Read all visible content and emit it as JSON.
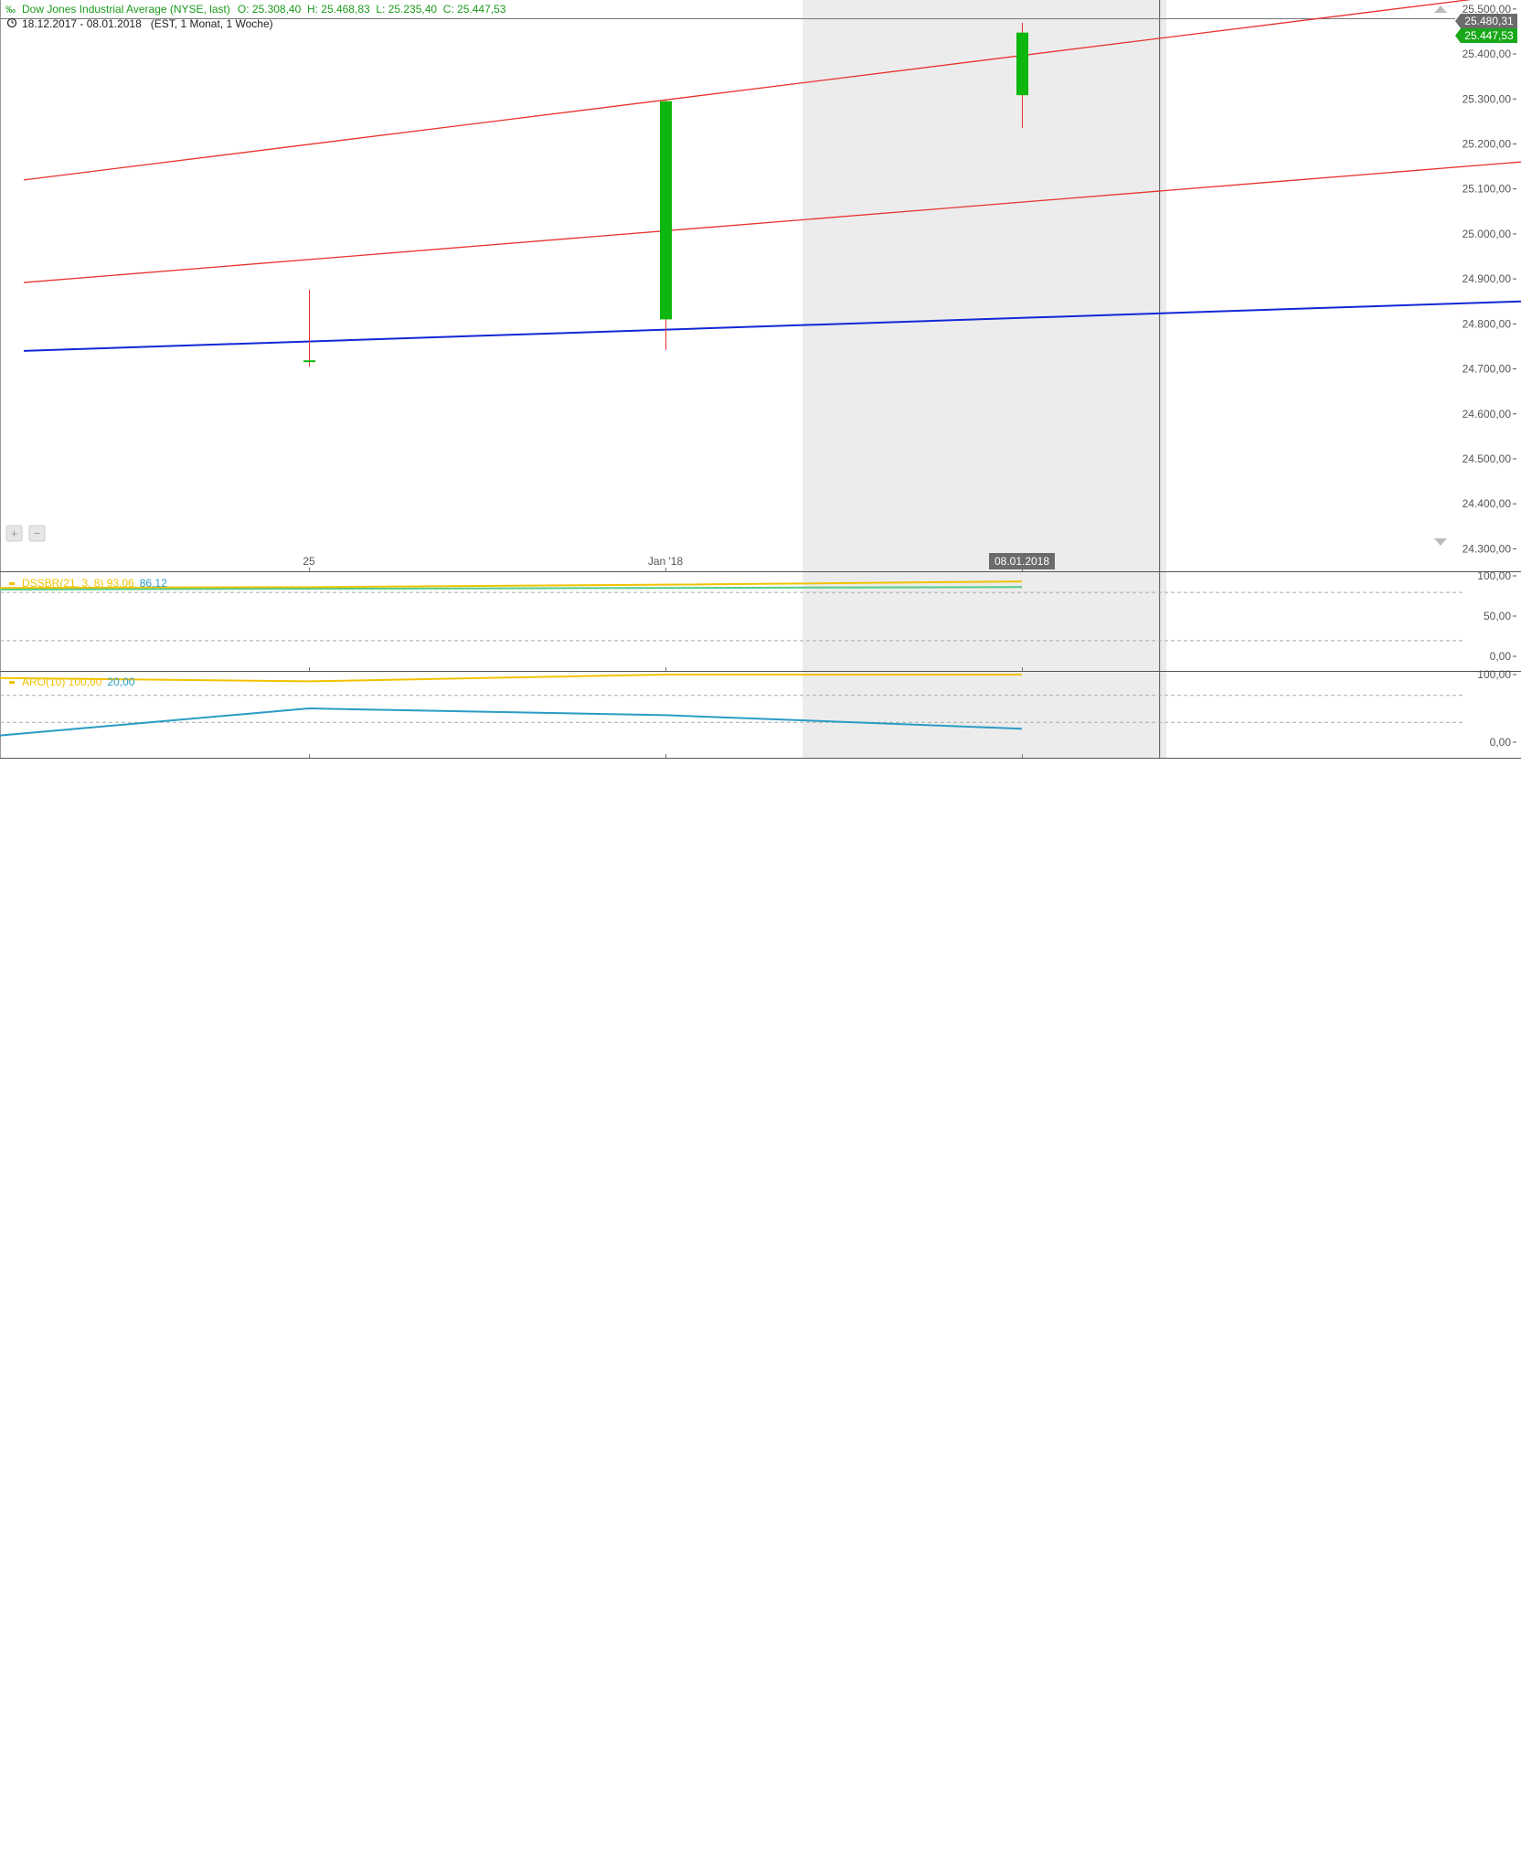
{
  "header": {
    "title": "Dow Jones Industrial Average (NYSE, last)",
    "ohlc": "O: 25.308,40  H: 25.468,83  L: 25.235,40  C: 25.447,53",
    "range": "18.12.2017 - 08.01.2018   (EST, 1 Monat, 1 Woche)"
  },
  "colors": {
    "up": "#0db70d",
    "wick": "#e8322e",
    "trend_red": "#e8322e",
    "trend_blue": "#1227d6",
    "header_green": "#1a9b1a",
    "dss_yellow": "#f2c200",
    "dss_green": "#55cc88",
    "aro_blue": "#2a9cc4",
    "badge_dark": "#6b6b6b",
    "badge_green": "#19a819"
  },
  "price_badges": {
    "last_high": "25.480,31",
    "last_close": "25.447,53"
  },
  "date_badge": "08.01.2018",
  "chart_data": [
    {
      "type": "candlestick",
      "title": "Dow Jones Industrial Average (NYSE, last)",
      "x_labels": [
        "25",
        "Jan '18"
      ],
      "ylim": [
        24250,
        25520
      ],
      "y_ticks": [
        24300,
        24400,
        24500,
        24600,
        24700,
        24800,
        24900,
        25000,
        25100,
        25200,
        25300,
        25400,
        25500
      ],
      "y_tick_labels": [
        "24.300,00",
        "24.400,00",
        "24.500,00",
        "24.600,00",
        "24.700,00",
        "24.800,00",
        "24.900,00",
        "25.000,00",
        "25.100,00",
        "25.200,00",
        "25.300,00",
        "25.400,00",
        "25.500,00"
      ],
      "candles": [
        {
          "date": "25.12.2017",
          "open": 24715,
          "high": 24876,
          "low": 24705,
          "close": 24719
        },
        {
          "date": "01.01.2018",
          "open": 24810,
          "high": 25299,
          "low": 24742,
          "close": 25295
        },
        {
          "date": "08.01.2018",
          "open": 25308.4,
          "high": 25468.83,
          "low": 25235.4,
          "close": 25447.53
        }
      ],
      "trendlines": [
        {
          "color": "red",
          "from": {
            "x": -0.8,
            "y": 25120
          },
          "to": {
            "x": 3.4,
            "y": 25535
          }
        },
        {
          "color": "red",
          "from": {
            "x": -0.8,
            "y": 24892
          },
          "to": {
            "x": 3.4,
            "y": 25160
          }
        },
        {
          "color": "blue",
          "from": {
            "x": -0.8,
            "y": 24740
          },
          "to": {
            "x": 3.4,
            "y": 24850
          }
        }
      ],
      "grid": false
    },
    {
      "type": "line",
      "legend": "DSSBR(21, 3, 8)",
      "legend_values": [
        "93,06",
        "86,12"
      ],
      "ylim": [
        0,
        100
      ],
      "y_ticks": [
        0,
        50,
        100
      ],
      "y_tick_labels": [
        "0,00",
        "50,00",
        "100,00"
      ],
      "reference_lines": [
        20,
        80
      ],
      "series": [
        {
          "values": [
            85,
            86,
            89,
            93.06
          ]
        },
        {
          "values": [
            83,
            84,
            85,
            86.12
          ]
        }
      ]
    },
    {
      "type": "line",
      "legend": "ARO(10)",
      "legend_values": [
        "100,00",
        "20,00"
      ],
      "ylim": [
        0,
        100
      ],
      "y_ticks": [
        0,
        100
      ],
      "y_tick_labels": [
        "0,00",
        "100,00"
      ],
      "reference_lines": [
        30,
        70
      ],
      "series": [
        {
          "values": [
            95,
            90,
            100,
            100
          ]
        },
        {
          "values": [
            10,
            50,
            40,
            20
          ]
        }
      ]
    }
  ]
}
